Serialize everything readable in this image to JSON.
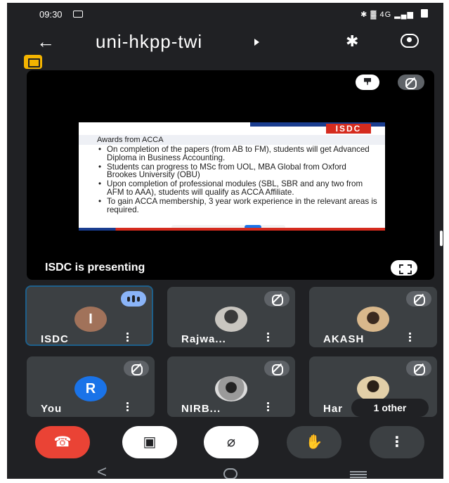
{
  "status_bar": {
    "time": "09:30",
    "icons_right": "✱ ▓ 4G ▂▄▆",
    "icons": [
      "cast-icon",
      "bluetooth-icon",
      "vibrate-icon",
      "signal-icon",
      "battery-icon"
    ]
  },
  "app_bar": {
    "back_icon": "←",
    "meeting_code": "uni-hkpp-twi",
    "bluetooth_icon": "✱"
  },
  "stage": {
    "presenting_label": "ISDC is presenting",
    "slide": {
      "logo": "ISDC",
      "heading": "Awards from ACCA",
      "bullets": [
        "On completion of the papers (from AB to FM), students will get Advanced Diploma in Business Accounting.",
        "Students can progress to MSc from UOL, MBA Global from Oxford Brookes University (OBU)",
        "Upon completion of professional modules (SBL, SBR and any two from AFM to AAA), students will qualify as ACCA Affiliate.",
        "To gain ACCA membership, 3 year work experience in the relevant areas is required."
      ]
    }
  },
  "participants": [
    {
      "name": "ISDC",
      "initial": "I",
      "avatar_color": "#a1725a",
      "state": "speaking"
    },
    {
      "name": "Rajwa...",
      "initial": "",
      "avatar_color": "#7f8088",
      "state": "muted"
    },
    {
      "name": "AKASH",
      "initial": "",
      "avatar_color": "#b08a60",
      "state": "muted"
    },
    {
      "name": "You",
      "initial": "R",
      "avatar_color": "#1a73e8",
      "state": "muted"
    },
    {
      "name": "NIRB...",
      "initial": "",
      "avatar_color": "#6c6c6c",
      "state": "muted"
    },
    {
      "name": "Har",
      "initial": "",
      "avatar_color": "#b8a079",
      "state": "muted",
      "overlay": "1 other"
    }
  ],
  "controls": {
    "end_call_icon": "☎",
    "camera_off_icon": "▣",
    "mic_off_icon": "⌀",
    "raise_hand_icon": "✋",
    "more_icon": "⋮"
  },
  "nav_bar": {
    "back_icon": "<"
  },
  "colors": {
    "background": "#202124",
    "tile": "#3c4043",
    "end_call": "#ea4335",
    "accent_blue": "#8ab4f8",
    "badge_yellow": "#f4b400"
  }
}
